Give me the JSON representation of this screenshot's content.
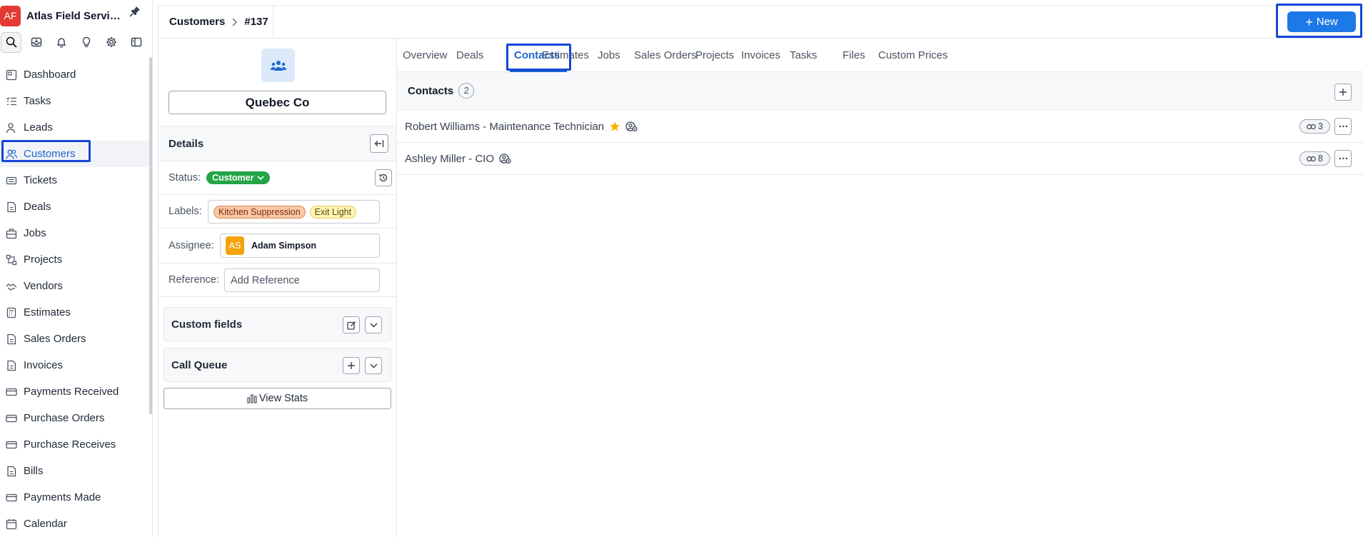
{
  "app": {
    "logo_text": "AF",
    "name": "Atlas Field Servic..."
  },
  "nav": {
    "items": [
      {
        "label": "Dashboard",
        "icon": "dashboard-icon"
      },
      {
        "label": "Tasks",
        "icon": "tasks-icon"
      },
      {
        "label": "Leads",
        "icon": "leads-icon"
      },
      {
        "label": "Customers",
        "icon": "customers-icon"
      },
      {
        "label": "Tickets",
        "icon": "tickets-icon"
      },
      {
        "label": "Deals",
        "icon": "deals-icon"
      },
      {
        "label": "Jobs",
        "icon": "jobs-icon"
      },
      {
        "label": "Projects",
        "icon": "projects-icon"
      },
      {
        "label": "Vendors",
        "icon": "vendors-icon"
      },
      {
        "label": "Estimates",
        "icon": "estimates-icon"
      },
      {
        "label": "Sales Orders",
        "icon": "sales-orders-icon"
      },
      {
        "label": "Invoices",
        "icon": "invoices-icon"
      },
      {
        "label": "Payments Received",
        "icon": "payments-received-icon"
      },
      {
        "label": "Purchase Orders",
        "icon": "purchase-orders-icon"
      },
      {
        "label": "Purchase Receives",
        "icon": "purchase-receives-icon"
      },
      {
        "label": "Bills",
        "icon": "bills-icon"
      },
      {
        "label": "Payments Made",
        "icon": "payments-made-icon"
      },
      {
        "label": "Calendar",
        "icon": "calendar-icon"
      }
    ],
    "active": "Customers"
  },
  "header": {
    "crumb_root": "Customers",
    "crumb_id": "#137",
    "new_label": "New"
  },
  "customer": {
    "name": "Quebec Co",
    "details_title": "Details",
    "status_label": "Status:",
    "status_value": "Customer",
    "labels_label": "Labels:",
    "labels": [
      "Kitchen Suppression",
      "Exit Light"
    ],
    "assignee_label": "Assignee:",
    "assignee_initials": "AS",
    "assignee_name": "Adam Simpson",
    "reference_label": "Reference:",
    "reference_placeholder": "Add Reference",
    "custom_fields_title": "Custom fields",
    "call_queue_title": "Call Queue",
    "view_stats_label": "View Stats"
  },
  "tabs": [
    "Overview",
    "Deals",
    "Contacts",
    "Estimates",
    "Jobs",
    "Sales Orders",
    "Projects",
    "Invoices",
    "Tasks",
    "Files",
    "Custom Prices"
  ],
  "active_tab": "Contacts",
  "contacts": {
    "title": "Contacts",
    "count": "2",
    "rows": [
      {
        "label": "Robert Williams - Maintenance Technician",
        "starred": true,
        "links": "3"
      },
      {
        "label": "Ashley Miller - CIO",
        "starred": false,
        "links": "8"
      }
    ]
  },
  "colors": {
    "accent": "#1e66d0",
    "primary_button": "#1d78e8",
    "status_green": "#22a447",
    "logo_red": "#e53935",
    "highlight_box": "#1447d6"
  }
}
